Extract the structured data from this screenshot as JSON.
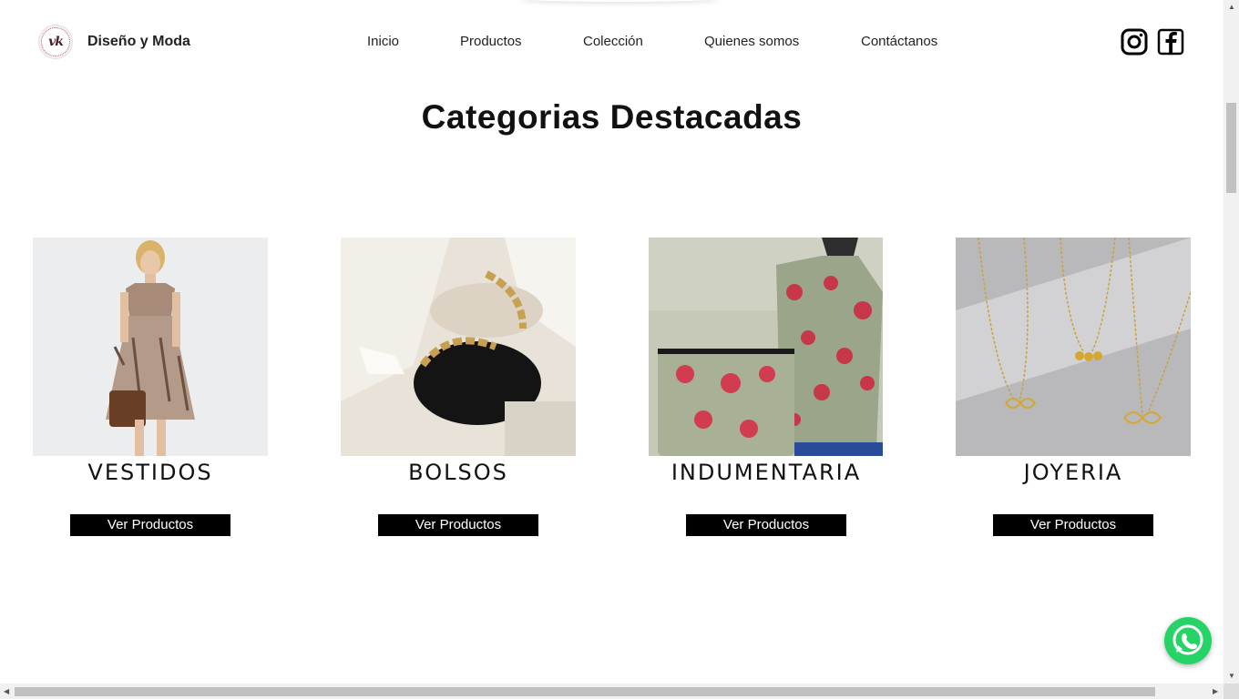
{
  "header": {
    "brand": "Diseño y Moda",
    "logo_text": "vk",
    "nav": [
      "Inicio",
      "Productos",
      "Colección",
      "Quienes somos",
      "Contáctanos"
    ]
  },
  "title": "Categorias Destacadas",
  "categories": [
    {
      "name": "VESTIDOS",
      "button": "Ver Productos"
    },
    {
      "name": "BOLSOS",
      "button": "Ver Productos"
    },
    {
      "name": "INDUMENTARIA",
      "button": "Ver Productos"
    },
    {
      "name": "JOYERIA",
      "button": "Ver Productos"
    }
  ],
  "icons": [
    "instagram-icon",
    "facebook-icon",
    "whatsapp-icon"
  ],
  "colors": {
    "button_bg": "#000000",
    "button_text": "#ffffff",
    "whatsapp": "#25d366"
  }
}
